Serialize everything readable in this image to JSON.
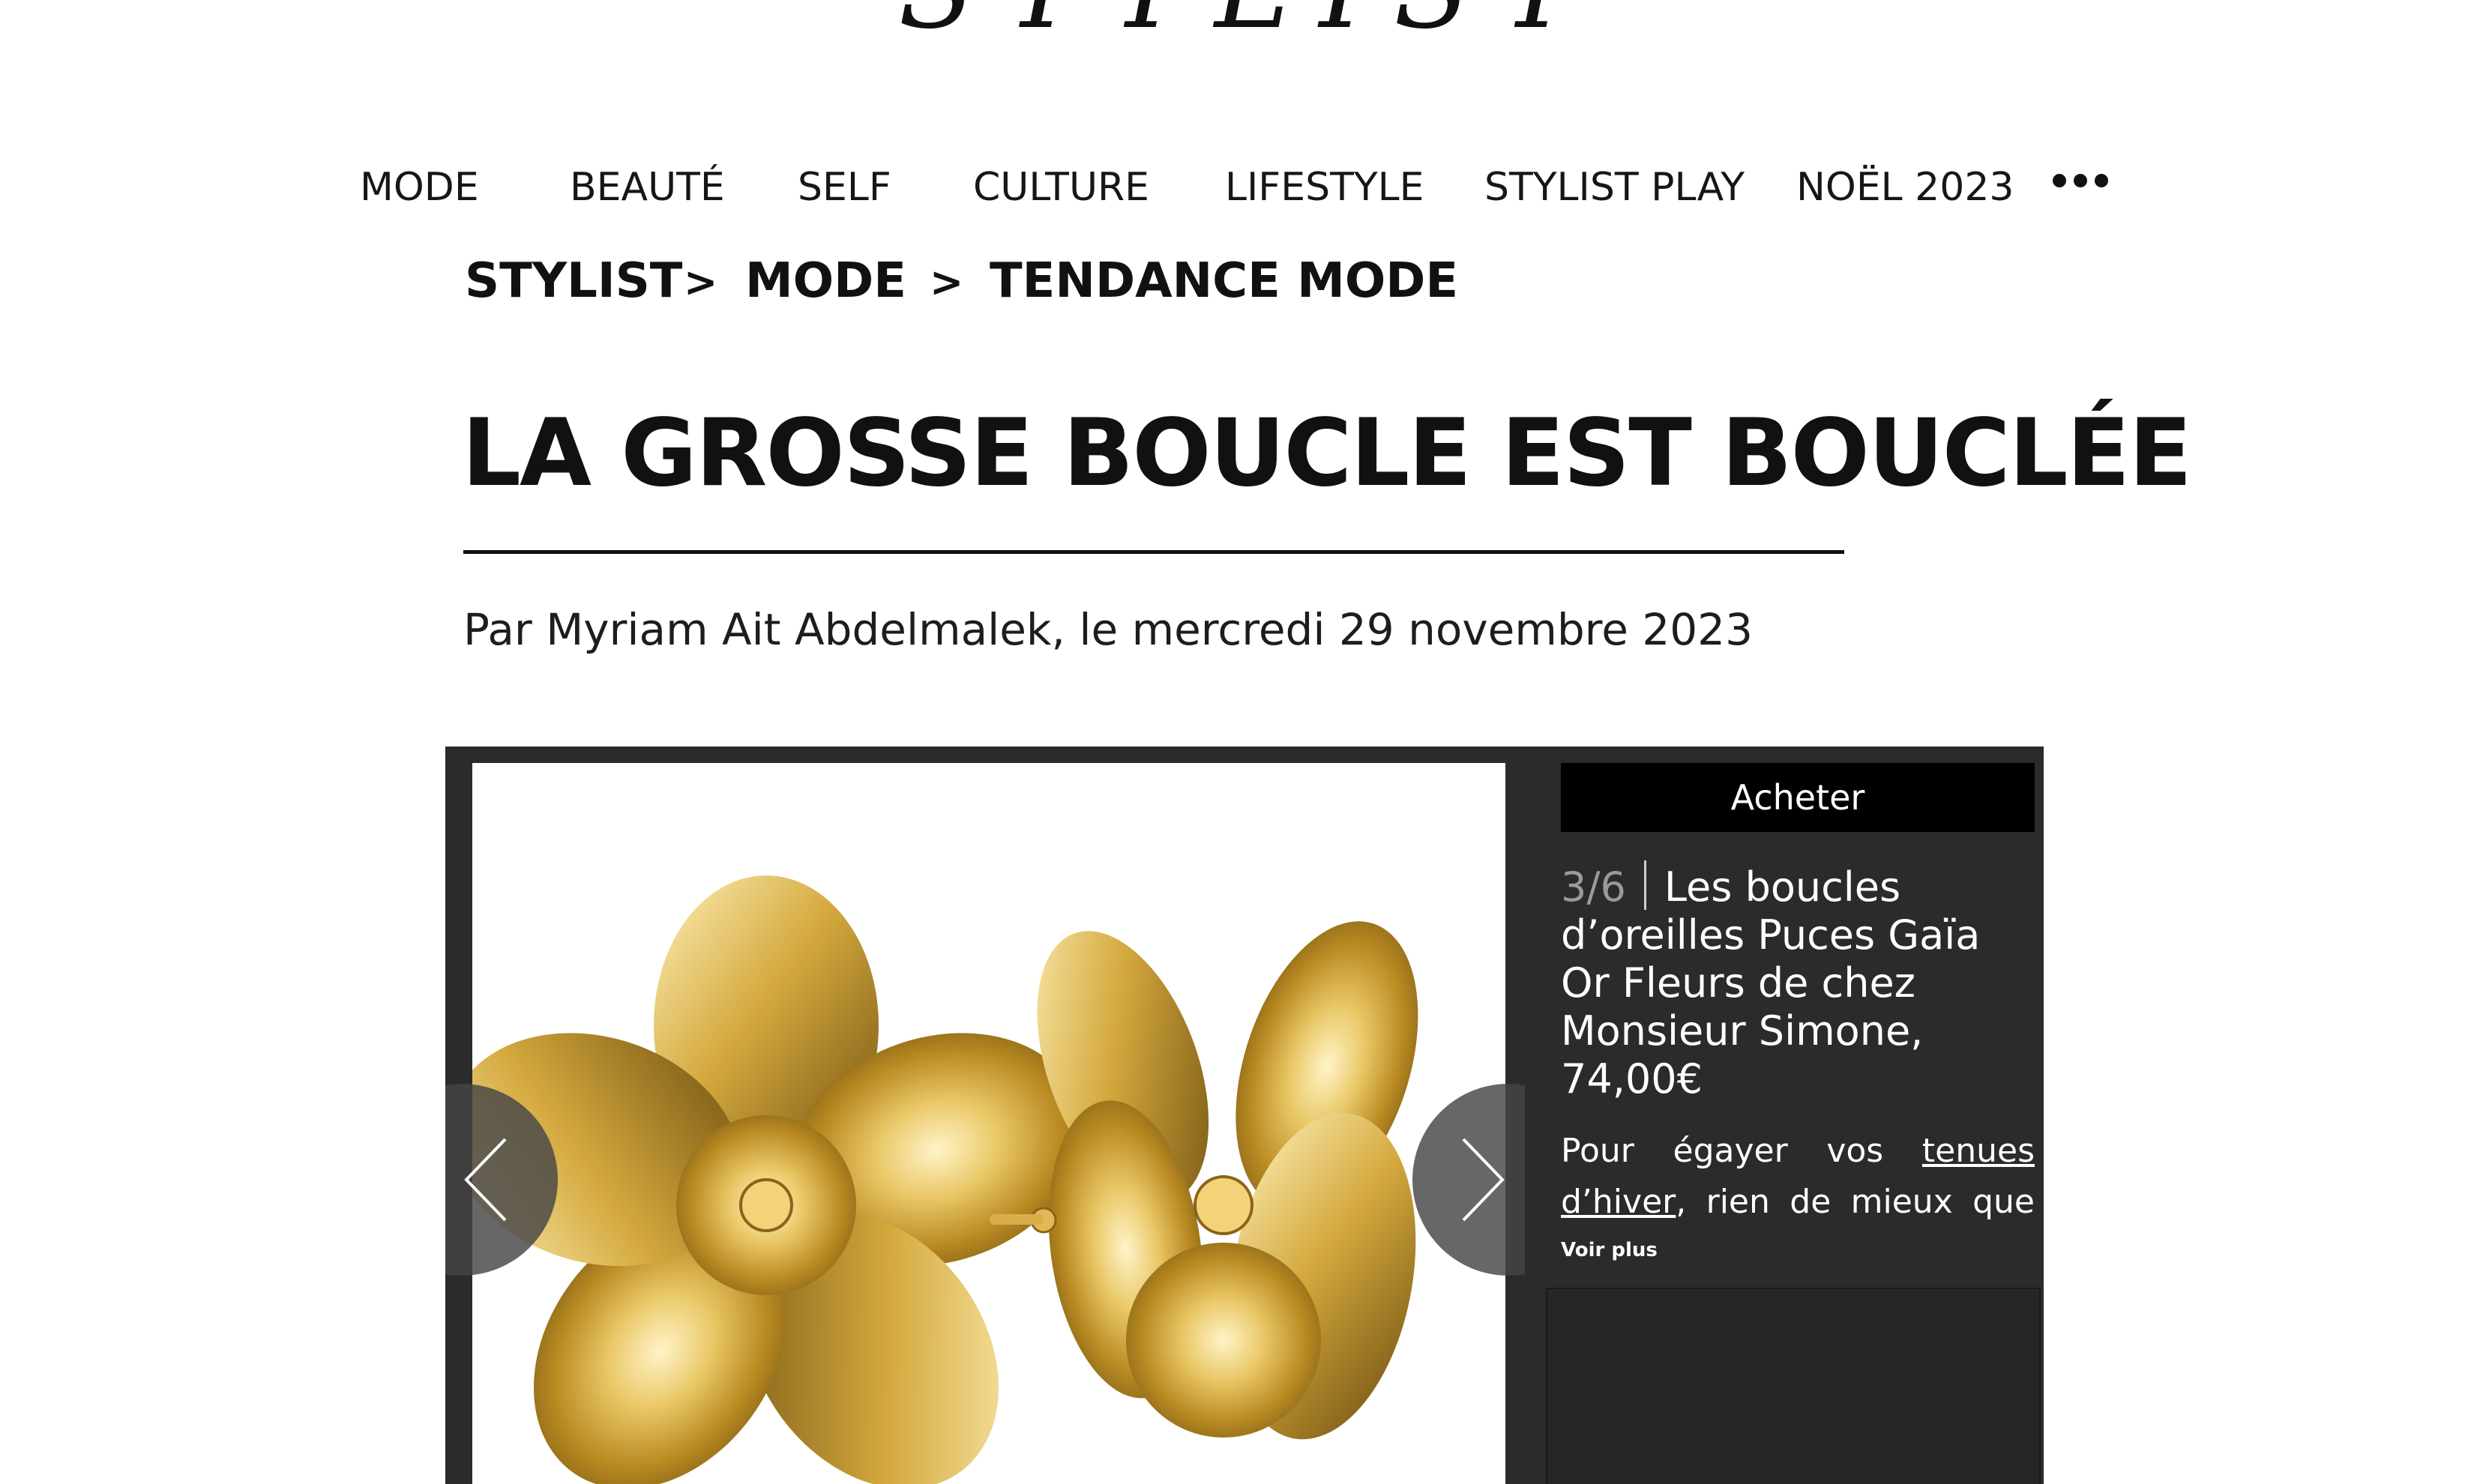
{
  "logo": {
    "text": "STYLIST"
  },
  "nav": {
    "items": [
      "MODE",
      "BEAUTÉ",
      "SELF",
      "CULTURE",
      "LIFESTYLE",
      "STYLIST PLAY",
      "NOËL 2023"
    ],
    "more_icon": "more-horizontal-icon"
  },
  "breadcrumb": {
    "items": [
      "STYLIST",
      "MODE",
      "TENDANCE MODE"
    ],
    "separator": ">"
  },
  "article": {
    "title": "LA GROSSE BOUCLE EST BOUCLÉE",
    "byline": "Par Myriam Ait Abdelmalek, le mercredi 29 novembre 2023"
  },
  "slideshow": {
    "buy_label": "Acheter",
    "counter": "3/6",
    "title": "Les boucles d’oreilles Puces Gaïa Or Fleurs de chez Monsieur Simone, 74,00€",
    "description_prefix": "Pour égayer vos ",
    "description_link": "tenues d’hiver",
    "description_suffix": ", rien de mieux que les",
    "see_more_label": "Voir plus",
    "prev_icon": "chevron-left-icon",
    "next_icon": "chevron-right-icon",
    "image_subject": "gold-flower-earrings-image"
  },
  "colors": {
    "text": "#111111",
    "slideshow_bg": "#2b2b2b",
    "button_bg": "#000000",
    "counter": "#9a9a9a",
    "gold": "#d8b04a"
  }
}
